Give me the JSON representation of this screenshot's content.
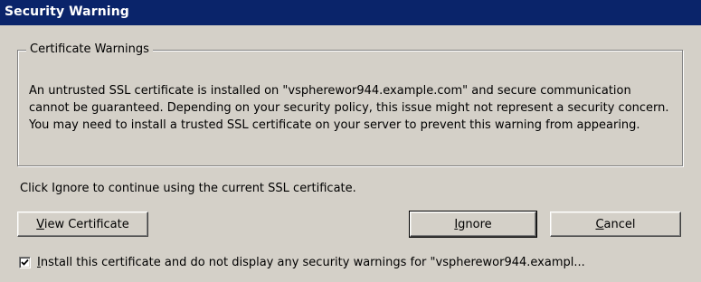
{
  "window": {
    "title": "Security Warning"
  },
  "group": {
    "legend": "Certificate Warnings",
    "message": "An untrusted SSL certificate is installed on \"vspherewor944.example.com\" and secure communication cannot be guaranteed.  Depending on your security policy, this issue might not represent a security concern.  You may need to install a trusted SSL certificate on your server to prevent this warning from appearing."
  },
  "note": "Click Ignore to continue using the current SSL certificate.",
  "buttons": {
    "view_certificate": "View Certificate",
    "ignore": "Ignore",
    "cancel": "Cancel"
  },
  "install_checkbox": {
    "checked": true,
    "label_first_char": "I",
    "label_rest": "nstall this certificate and do not display any security warnings for \"vspherewor944.exampl..."
  },
  "colors": {
    "titlebar": "#0a246a",
    "face": "#d4d0c8"
  }
}
